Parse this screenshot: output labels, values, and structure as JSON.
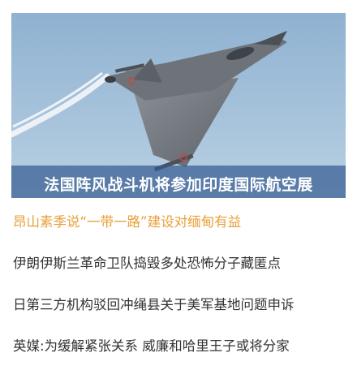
{
  "hero": {
    "caption": "法国阵风战斗机将参加印度国际航空展",
    "image_icon": "fighter-jet-photo"
  },
  "headlines": [
    {
      "text": "昂山素季说“一带一路”建设对缅甸有益",
      "highlighted": true
    },
    {
      "text": "伊朗伊斯兰革命卫队捣毁多处恐怖分子藏匿点",
      "highlighted": false
    },
    {
      "text": "日第三方机构驳回冲绳县关于美军基地问题申诉",
      "highlighted": false
    },
    {
      "text": "英媒:为缓解紧张关系 威廉和哈里王子或将分家",
      "highlighted": false
    }
  ],
  "colors": {
    "highlight": "#e8a03a",
    "text": "#333333",
    "caption_bg": "#355c91",
    "sky": "#a6c3da"
  }
}
